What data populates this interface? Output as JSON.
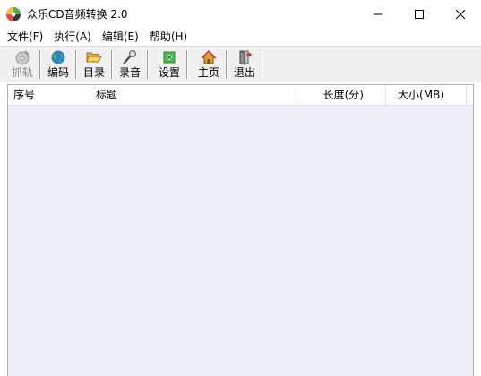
{
  "window": {
    "title": "众乐CD音频转换 2.0",
    "app_icon": "cd-disc-icon",
    "controls": [
      "minimize-icon",
      "maximize-icon",
      "close-icon"
    ]
  },
  "menu": {
    "items": [
      {
        "label": "文件(F)"
      },
      {
        "label": "执行(A)"
      },
      {
        "label": "编辑(E)"
      },
      {
        "label": "帮助(H)"
      }
    ]
  },
  "toolbar": {
    "rip": {
      "label": "抓轨",
      "icon": "cd-rip-icon",
      "enabled": false
    },
    "encode": {
      "label": "编码",
      "icon": "globe-icon",
      "enabled": true
    },
    "directory": {
      "label": "目录",
      "icon": "folder-open-icon",
      "enabled": true
    },
    "record": {
      "label": "录音",
      "icon": "microphone-icon",
      "enabled": true
    },
    "settings": {
      "label": "设置",
      "icon": "settings-icon",
      "enabled": true
    },
    "home": {
      "label": "主页",
      "icon": "home-icon",
      "enabled": true
    },
    "exit": {
      "label": "退出",
      "icon": "exit-door-icon",
      "enabled": true
    }
  },
  "table": {
    "columns": [
      {
        "label": "序号"
      },
      {
        "label": "标题"
      },
      {
        "label": "长度(分)"
      },
      {
        "label": "大小(MB)"
      }
    ],
    "rows": []
  },
  "colors": {
    "list_background": "#efeffb",
    "toolbar_background": "#f0f0f0",
    "disabled_text": "#8c8c8c"
  }
}
